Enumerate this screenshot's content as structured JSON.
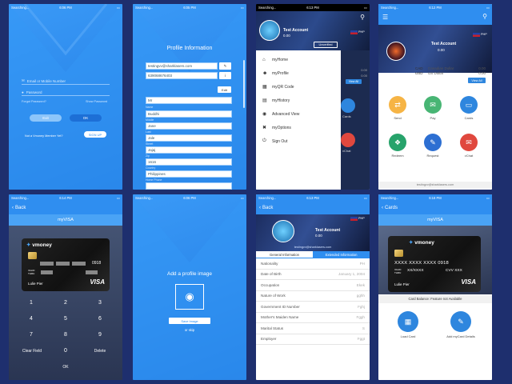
{
  "status": {
    "carrier": "Searching...",
    "wifi": "◠",
    "battery": "▭"
  },
  "screen1": {
    "time": "6:06 PM",
    "email_placeholder": "Email or Mobile Number",
    "password_placeholder": "Password",
    "forgot": "Forgot Password?",
    "show": "Show Password",
    "exit": "Exit",
    "ok": "OK",
    "not_member": "Not a Vmoney Member Yet?",
    "signup": "SIGN UP"
  },
  "screen2": {
    "time": "6:05 PM",
    "title": "Profile Information",
    "email": "testingvv@sharklasers.com",
    "phone": "639068676403",
    "edit": "Edit",
    "name": "Mr",
    "lbl1": "Name",
    "first": "Buddhi",
    "lbl2": "Middle",
    "middle": "Jane",
    "lbl3": "Last",
    "last": "Jale",
    "lbl4": "Street",
    "street": "Jajaj",
    "lbl5": "Zip",
    "zip": "1616",
    "lbl6": "Country",
    "country": "Philippines",
    "lbl7": "Home Phone"
  },
  "screen3": {
    "time": "6:13 PM",
    "account": "Test Account",
    "balance": "0.00",
    "unverified": "Unverified",
    "flag_label": "PHP",
    "menu": [
      {
        "icon": "home-icon",
        "glyph": "⌂",
        "label": "myHome"
      },
      {
        "icon": "person-icon",
        "glyph": "☻",
        "label": "myProfile"
      },
      {
        "icon": "qr-icon",
        "glyph": "▦",
        "label": "myQR Code"
      },
      {
        "icon": "calendar-icon",
        "glyph": "▤",
        "label": "myHistory"
      },
      {
        "icon": "eye-icon",
        "glyph": "◉",
        "label": "Advanced View"
      },
      {
        "icon": "tools-icon",
        "glyph": "✖",
        "label": "myOptions"
      },
      {
        "icon": "power-icon",
        "glyph": "⏻",
        "label": "Sign Out"
      }
    ],
    "peek_amounts": [
      "0.00",
      "0.00"
    ],
    "peek_btn": "View All",
    "peek_labels": [
      "Cards",
      "vChat"
    ]
  },
  "screen4": {
    "time": "6:12 PM",
    "account": "Test Account",
    "flag_label": "PHP",
    "amounts": [
      "0.00",
      "0.00",
      "0.00"
    ],
    "currencies": [
      {
        "code": "CAD",
        "name": "Canadian Dollar"
      },
      {
        "code": "USD",
        "name": "US Dollar"
      }
    ],
    "view_all": "View All",
    "icons": [
      {
        "label": "Send",
        "color": "#f6b445",
        "glyph": "⇄"
      },
      {
        "label": "Pay",
        "color": "#48b574",
        "glyph": "✉"
      },
      {
        "label": "Cards",
        "color": "#2e86de",
        "glyph": "▭"
      },
      {
        "label": "Redeem",
        "color": "#27a36b",
        "glyph": "❖"
      },
      {
        "label": "Request",
        "color": "#2d6fd2",
        "glyph": "✎"
      },
      {
        "label": "vChat",
        "color": "#e0483e",
        "glyph": "✉"
      }
    ],
    "footer": "testingvv@sharklasers.com"
  },
  "screen5": {
    "time": "6:14 PM",
    "back": "Back",
    "title": "myVISA",
    "brand": "vmoney",
    "number_end": "0918",
    "valid": "VALID THRU",
    "cardholder": "Lulie Pier",
    "visa": "VISA",
    "keys": [
      "1",
      "2",
      "3",
      "4",
      "5",
      "6",
      "7",
      "8",
      "9",
      "Clear Field",
      "0",
      "Delete"
    ],
    "ok": "OK"
  },
  "screen6": {
    "time": "6:06 PM",
    "title": "Add a profile image",
    "save": "Save Image",
    "skip": "or skip"
  },
  "screen7": {
    "time": "6:13 PM",
    "back": "Back",
    "account": "Test Account",
    "balance": "0.00",
    "flag_label": "PHP",
    "email": "testingvv@sharklasers.com",
    "tabs": [
      "General Information",
      "Extended Information"
    ],
    "rows": [
      {
        "k": "Nationality",
        "v": "PH"
      },
      {
        "k": "Date of Birth",
        "v": "January 1, 2004"
      },
      {
        "k": "Occupation",
        "v": "Ekek"
      },
      {
        "k": "Nature of Work",
        "v": "gghh"
      },
      {
        "k": "Government ID Number",
        "v": "Fghj"
      },
      {
        "k": "Mother's Maiden Name",
        "v": "Fggh"
      },
      {
        "k": "Marital Status",
        "v": "S"
      },
      {
        "k": "Employer",
        "v": "Fggt"
      }
    ]
  },
  "screen8": {
    "time": "6:18 PM",
    "back": "Cards",
    "title": "myVISA",
    "brand": "vmoney",
    "number": "XXXX XXXX XXXX 0918",
    "valid": "VALID THRU",
    "exp": "XX/XXXX",
    "cvv": "CVV XXX",
    "cardholder": "Lulie Pier",
    "visa": "VISA",
    "balance": "Card Balance: Feature not Available",
    "load": "Load Card",
    "add": "Add myCard Details"
  }
}
